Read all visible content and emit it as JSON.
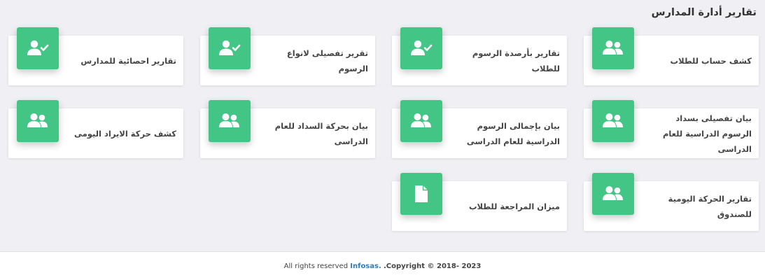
{
  "page": {
    "title": "تقارير أدارة المدارس"
  },
  "colors": {
    "tile": "#43c585",
    "brand": "#2f7db8"
  },
  "cards": [
    {
      "label": "كشف حساب للطلاب",
      "icon": "users-icon"
    },
    {
      "label": "تقارير بأرصدة الرسوم للطلاب",
      "icon": "user-check-icon"
    },
    {
      "label": "تقرير تفصيلى لانواع الرسوم",
      "icon": "user-check-icon"
    },
    {
      "label": "تقارير احصائية للمدارس",
      "icon": "user-check-icon"
    },
    {
      "label": "بيان تفصيلى بسداد الرسوم الدراسية للعام الدراسى",
      "icon": "users-icon"
    },
    {
      "label": "بيان بإجمالى الرسوم الدراسية للعام الدراسى",
      "icon": "users-icon"
    },
    {
      "label": "بيان بحركة السداد للعام الدراسى",
      "icon": "users-icon"
    },
    {
      "label": "كشف حركة الايراد اليومى",
      "icon": "users-icon"
    },
    {
      "label": "تقارير الحركة اليومية للصندوق",
      "icon": "users-icon"
    },
    {
      "label": "ميزان المراجعة للطلاب",
      "icon": "file-icon"
    }
  ],
  "footer": {
    "copyright": ".Copyright © 2018- 2023",
    "brand": "Infosas.",
    "rights": "All rights reserved"
  }
}
